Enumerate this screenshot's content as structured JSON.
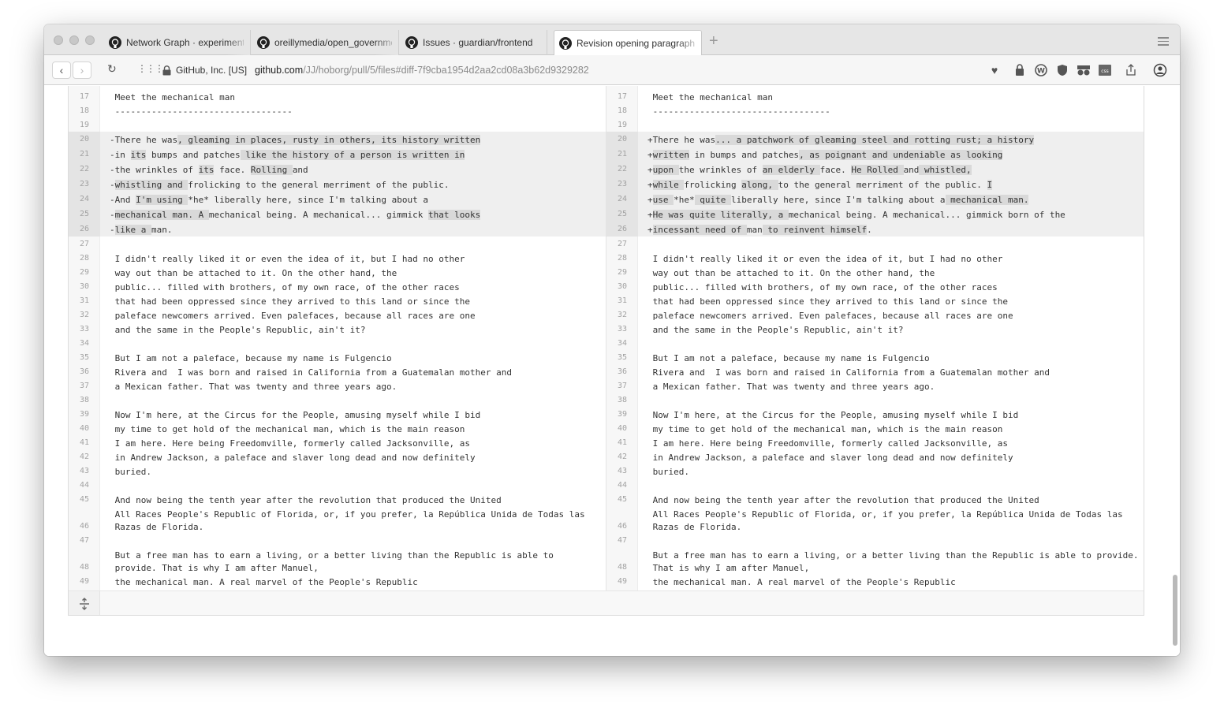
{
  "tabs": [
    {
      "label": "Network Graph · experimenta",
      "active": false
    },
    {
      "label": "oreillymedia/open_governme",
      "active": false
    },
    {
      "label": "Issues · guardian/frontend",
      "active": false
    },
    {
      "label": "Revision opening paragraph b",
      "active": true
    }
  ],
  "toolbar": {
    "site_identity": "GitHub, Inc. [US]",
    "url_host": "github.com",
    "url_path": "/JJ/hoborg/pull/5/files#diff-7f9cba1954d2aa2cd08a3b62d9329282"
  },
  "diff": {
    "left": [
      {
        "n": "17",
        "text": " Meet the mechanical man",
        "changed": false
      },
      {
        "n": "18",
        "text": " ----------------------------------",
        "changed": false
      },
      {
        "n": "19",
        "text": "",
        "changed": false
      },
      {
        "n": "20",
        "text": "-There he was, gleaming in places, rusty in others, its history written",
        "changed": true
      },
      {
        "n": "21",
        "text": "-in its bumps and patches like the history of a person is written in",
        "changed": true
      },
      {
        "n": "22",
        "text": "-the wrinkles of its face. Rolling and",
        "changed": true
      },
      {
        "n": "23",
        "text": "-whistling and frolicking to the general merriment of the public.",
        "changed": true
      },
      {
        "n": "24",
        "text": "-And I'm using *he* liberally here, since I'm talking about a",
        "changed": true
      },
      {
        "n": "25",
        "text": "-mechanical man. A mechanical being. A mechanical... gimmick that looks",
        "changed": true
      },
      {
        "n": "26",
        "text": "-like a man.",
        "changed": true
      },
      {
        "n": "27",
        "text": "",
        "changed": false
      },
      {
        "n": "28",
        "text": " I didn't really liked it or even the idea of it, but I had no other",
        "changed": false
      },
      {
        "n": "29",
        "text": " way out than be attached to it. On the other hand, the",
        "changed": false
      },
      {
        "n": "30",
        "text": " public... filled with brothers, of my own race, of the other races",
        "changed": false
      },
      {
        "n": "31",
        "text": " that had been oppressed since they arrived to this land or since the",
        "changed": false
      },
      {
        "n": "32",
        "text": " paleface newcomers arrived. Even palefaces, because all races are one",
        "changed": false
      },
      {
        "n": "33",
        "text": " and the same in the People's Republic, ain't it?",
        "changed": false
      },
      {
        "n": "34",
        "text": "",
        "changed": false
      },
      {
        "n": "35",
        "text": " But I am not a paleface, because my name is Fulgencio",
        "changed": false
      },
      {
        "n": "36",
        "text": " Rivera and  I was born and raised in California from a Guatemalan mother and",
        "changed": false
      },
      {
        "n": "37",
        "text": " a Mexican father. That was twenty and three years ago.",
        "changed": false
      },
      {
        "n": "38",
        "text": "",
        "changed": false
      },
      {
        "n": "39",
        "text": " Now I'm here, at the Circus for the People, amusing myself while I bid",
        "changed": false
      },
      {
        "n": "40",
        "text": " my time to get hold of the mechanical man, which is the main reason",
        "changed": false
      },
      {
        "n": "41",
        "text": " I am here. Here being Freedomville, formerly called Jacksonville, as",
        "changed": false
      },
      {
        "n": "42",
        "text": " in Andrew Jackson, a paleface and slaver long dead and now definitely",
        "changed": false
      },
      {
        "n": "43",
        "text": " buried.",
        "changed": false
      },
      {
        "n": "44",
        "text": "",
        "changed": false
      },
      {
        "n": "45",
        "text": " And now being the tenth year after the revolution that produced the United",
        "changed": false
      },
      {
        "n": "46",
        "text": " All Races People's Republic of Florida, or, if you prefer, la República Unida de Todas las\n Razas de Florida.",
        "changed": false
      },
      {
        "n": "47",
        "text": "",
        "changed": false
      },
      {
        "n": "48",
        "text": " But a free man has to earn a living, or a better living than the Republic is able to\n provide. That is why I am after Manuel,",
        "changed": false
      },
      {
        "n": "49",
        "text": " the mechanical man. A real marvel of the People's Republic",
        "changed": false
      }
    ],
    "right": [
      {
        "n": "17",
        "text": " Meet the mechanical man",
        "changed": false
      },
      {
        "n": "18",
        "text": " ----------------------------------",
        "changed": false
      },
      {
        "n": "19",
        "text": "",
        "changed": false
      },
      {
        "n": "20",
        "text": "+There he was... a patchwork of gleaming steel and rotting rust; a history",
        "changed": true
      },
      {
        "n": "21",
        "text": "+written in bumps and patches, as poignant and undeniable as looking",
        "changed": true
      },
      {
        "n": "22",
        "text": "+upon the wrinkles of an elderly face. He Rolled and whistled,",
        "changed": true
      },
      {
        "n": "23",
        "text": "+while frolicking along, to the general merriment of the public. I",
        "changed": true
      },
      {
        "n": "24",
        "text": "+use *he* quite liberally here, since I'm talking about a mechanical man.",
        "changed": true
      },
      {
        "n": "25",
        "text": "+He was quite literally, a mechanical being. A mechanical... gimmick born of the",
        "changed": true
      },
      {
        "n": "26",
        "text": "+incessant need of man to reinvent himself.",
        "changed": true
      },
      {
        "n": "27",
        "text": "",
        "changed": false
      },
      {
        "n": "28",
        "text": " I didn't really liked it or even the idea of it, but I had no other",
        "changed": false
      },
      {
        "n": "29",
        "text": " way out than be attached to it. On the other hand, the",
        "changed": false
      },
      {
        "n": "30",
        "text": " public... filled with brothers, of my own race, of the other races",
        "changed": false
      },
      {
        "n": "31",
        "text": " that had been oppressed since they arrived to this land or since the",
        "changed": false
      },
      {
        "n": "32",
        "text": " paleface newcomers arrived. Even palefaces, because all races are one",
        "changed": false
      },
      {
        "n": "33",
        "text": " and the same in the People's Republic, ain't it?",
        "changed": false
      },
      {
        "n": "34",
        "text": "",
        "changed": false
      },
      {
        "n": "35",
        "text": " But I am not a paleface, because my name is Fulgencio",
        "changed": false
      },
      {
        "n": "36",
        "text": " Rivera and  I was born and raised in California from a Guatemalan mother and",
        "changed": false
      },
      {
        "n": "37",
        "text": " a Mexican father. That was twenty and three years ago.",
        "changed": false
      },
      {
        "n": "38",
        "text": "",
        "changed": false
      },
      {
        "n": "39",
        "text": " Now I'm here, at the Circus for the People, amusing myself while I bid",
        "changed": false
      },
      {
        "n": "40",
        "text": " my time to get hold of the mechanical man, which is the main reason",
        "changed": false
      },
      {
        "n": "41",
        "text": " I am here. Here being Freedomville, formerly called Jacksonville, as",
        "changed": false
      },
      {
        "n": "42",
        "text": " in Andrew Jackson, a paleface and slaver long dead and now definitely",
        "changed": false
      },
      {
        "n": "43",
        "text": " buried.",
        "changed": false
      },
      {
        "n": "44",
        "text": "",
        "changed": false
      },
      {
        "n": "45",
        "text": " And now being the tenth year after the revolution that produced the United",
        "changed": false
      },
      {
        "n": "46",
        "text": " All Races People's Republic of Florida, or, if you prefer, la República Unida de Todas las\n Razas de Florida.",
        "changed": false
      },
      {
        "n": "47",
        "text": "",
        "changed": false
      },
      {
        "n": "48",
        "text": " But a free man has to earn a living, or a better living than the Republic is able to provide.\n That is why I am after Manuel,",
        "changed": false
      },
      {
        "n": "49",
        "text": " the mechanical man. A real marvel of the People's Republic",
        "changed": false
      }
    ],
    "left_highlights": {
      "20": [
        ", gleaming in places, rusty in others, its history written"
      ],
      "21": [
        "its",
        " like the history of a person is written in"
      ],
      "22": [
        "its",
        "Rolling "
      ],
      "23": [
        "whistling and "
      ],
      "24": [
        "I'm using "
      ],
      "25": [
        "mechanical man. A ",
        "that looks"
      ],
      "26": [
        "like a "
      ]
    },
    "right_highlights": {
      "20": [
        "... a patchwork of gleaming steel and rotting rust; a history"
      ],
      "21": [
        "written",
        ", as poignant and undeniable as looking"
      ],
      "22": [
        "upon ",
        "an elderly ",
        "He Rolled ",
        " whistled,"
      ],
      "23": [
        "while ",
        "along, ",
        "I"
      ],
      "24": [
        "use ",
        " quite ",
        " mechanical man."
      ],
      "25": [
        "He was quite literally, a ",
        "born of the "
      ],
      "26": [
        "incessant need of ",
        " to reinvent himself"
      ]
    }
  }
}
